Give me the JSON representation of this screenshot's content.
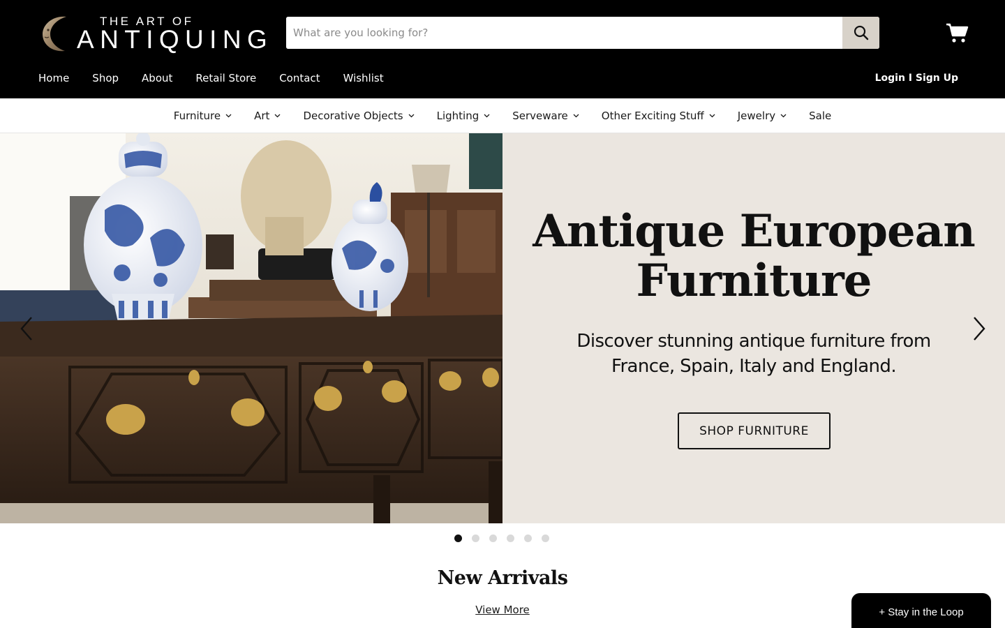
{
  "brand": {
    "logo_small": "THE ART OF",
    "logo_big": "ANTIQUING",
    "colors": {
      "header_bg": "#000000",
      "search_button_bg": "#d8d2c9",
      "hero_panel_bg": "#ebe6e0",
      "text": "#111111"
    }
  },
  "search": {
    "placeholder": "What are you looking for?",
    "value": "",
    "button_icon": "search-icon"
  },
  "cart": {
    "icon": "cart-icon"
  },
  "util_nav": [
    "Home",
    "Shop",
    "About",
    "Retail Store",
    "Contact",
    "Wishlist"
  ],
  "account": {
    "login_label": "Login I Sign Up"
  },
  "categories": [
    {
      "label": "Furniture",
      "has_dropdown": true
    },
    {
      "label": "Art",
      "has_dropdown": true
    },
    {
      "label": "Decorative Objects",
      "has_dropdown": true
    },
    {
      "label": "Lighting",
      "has_dropdown": true
    },
    {
      "label": "Serveware",
      "has_dropdown": true
    },
    {
      "label": "Other Exciting Stuff",
      "has_dropdown": true
    },
    {
      "label": "Jewelry",
      "has_dropdown": true
    },
    {
      "label": "Sale",
      "has_dropdown": false
    }
  ],
  "hero": {
    "title_line1": "Antique European",
    "title_line2": "Furniture",
    "subtitle_line1": "Discover stunning antique furniture from",
    "subtitle_line2": "France, Spain, Italy and England.",
    "cta_label": "SHOP FURNITURE",
    "slide_count": 6,
    "active_slide": 1
  },
  "new_arrivals": {
    "title": "New Arrivals",
    "link_label": "View More"
  },
  "newsletter": {
    "label": "+ Stay in the Loop"
  }
}
